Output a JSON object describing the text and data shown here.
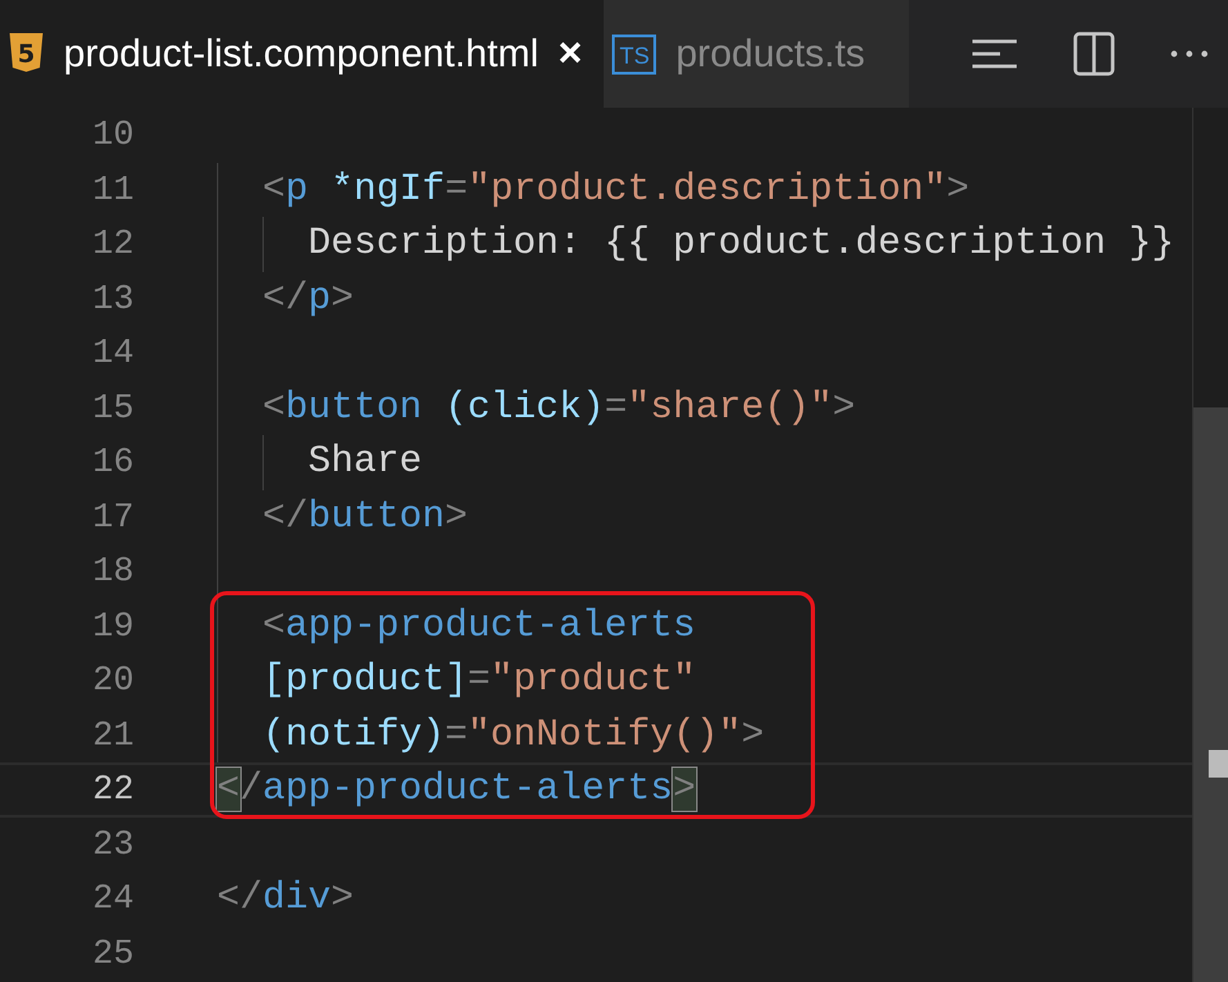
{
  "tabs": [
    {
      "label": "product-list.component.html",
      "selected": true,
      "icon": {
        "kind": "html5",
        "text": "5"
      },
      "close": "×"
    },
    {
      "label": "products.ts",
      "selected": false,
      "icon": {
        "kind": "ts",
        "text": "TS"
      }
    }
  ],
  "toolbar": [
    {
      "kind": "outline"
    },
    {
      "kind": "split"
    },
    {
      "kind": "more"
    }
  ],
  "lines": [
    {
      "number": "10",
      "current": false
    },
    {
      "number": "11",
      "current": false,
      "tokens": [
        {
          "kind": "punct",
          "text": "  <"
        },
        {
          "kind": "tag",
          "text": "p"
        },
        {
          "kind": "attr",
          "text": " *ngIf"
        },
        {
          "kind": "punct",
          "text": "="
        },
        {
          "kind": "str",
          "text": "\"product.description\""
        },
        {
          "kind": "punct",
          "text": ">"
        }
      ]
    },
    {
      "number": "12",
      "current": false,
      "tokens": [
        {
          "kind": "text",
          "text": "    Description: {{ product.description }}"
        }
      ]
    },
    {
      "number": "13",
      "current": false,
      "tokens": [
        {
          "kind": "punct",
          "text": "  </"
        },
        {
          "kind": "tag",
          "text": "p"
        },
        {
          "kind": "punct",
          "text": ">"
        }
      ]
    },
    {
      "number": "14",
      "current": false
    },
    {
      "number": "15",
      "current": false,
      "tokens": [
        {
          "kind": "punct",
          "text": "  <"
        },
        {
          "kind": "tag",
          "text": "button"
        },
        {
          "kind": "attr",
          "text": " (click)"
        },
        {
          "kind": "punct",
          "text": "="
        },
        {
          "kind": "str",
          "text": "\"share()\""
        },
        {
          "kind": "punct",
          "text": ">"
        }
      ]
    },
    {
      "number": "16",
      "current": false,
      "tokens": [
        {
          "kind": "text",
          "text": "    Share"
        }
      ]
    },
    {
      "number": "17",
      "current": false,
      "tokens": [
        {
          "kind": "punct",
          "text": "  </"
        },
        {
          "kind": "tag",
          "text": "button"
        },
        {
          "kind": "punct",
          "text": ">"
        }
      ]
    },
    {
      "number": "18",
      "current": false
    },
    {
      "number": "19",
      "current": false,
      "tokens": [
        {
          "kind": "punct",
          "text": "  <"
        },
        {
          "kind": "tag",
          "text": "app-product-alerts"
        }
      ]
    },
    {
      "number": "20",
      "current": false,
      "tokens": [
        {
          "kind": "attr",
          "text": "  [product]"
        },
        {
          "kind": "punct",
          "text": "="
        },
        {
          "kind": "str",
          "text": "\"product\""
        }
      ]
    },
    {
      "number": "21",
      "current": false,
      "tokens": [
        {
          "kind": "attr",
          "text": "  (notify)"
        },
        {
          "kind": "punct",
          "text": "="
        },
        {
          "kind": "str",
          "text": "\"onNotify()\""
        },
        {
          "kind": "punct",
          "text": ">"
        }
      ]
    },
    {
      "number": "22",
      "current": true,
      "tokens": [
        {
          "kind": "punct",
          "text": "<",
          "match": true
        },
        {
          "kind": "punct",
          "text": "/"
        },
        {
          "kind": "tag",
          "text": "app-product-alerts"
        },
        {
          "kind": "punct",
          "text": ">",
          "match": true
        }
      ]
    },
    {
      "number": "23",
      "current": false
    },
    {
      "number": "24",
      "current": false,
      "tokens": [
        {
          "kind": "punct",
          "text": "</"
        },
        {
          "kind": "tag",
          "text": "div"
        },
        {
          "kind": "punct",
          "text": ">"
        }
      ]
    },
    {
      "number": "25",
      "current": false
    }
  ]
}
